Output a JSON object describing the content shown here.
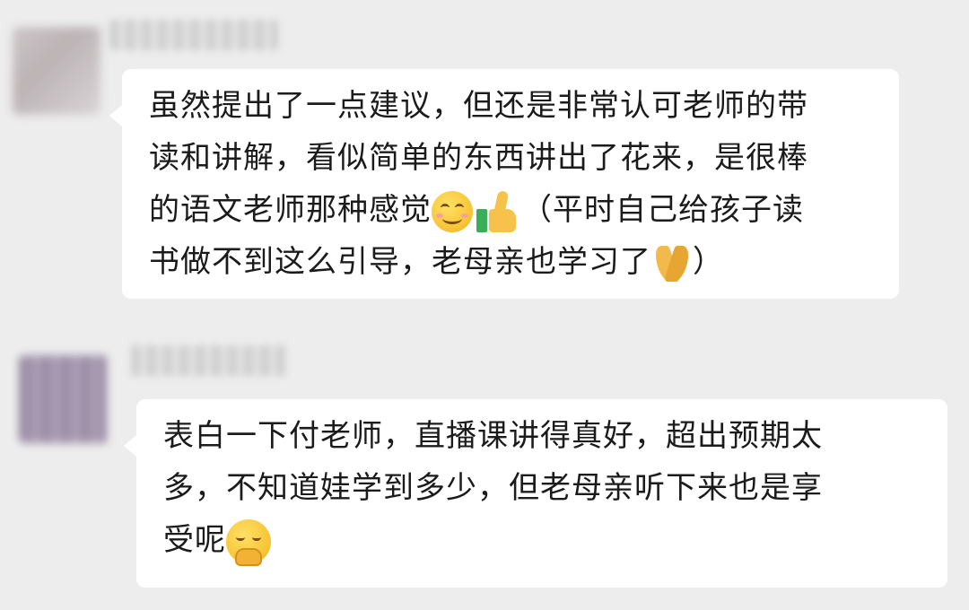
{
  "messages": [
    {
      "lines": [
        "虽然提出了一点建议，但还是非常认可老师的带",
        "读和讲解，看似简单的东西讲出了花来，是很棒",
        "的语文老师那种感觉",
        "（平时自己给孩子读",
        "书做不到这么引导，老母亲也学习了",
        "）"
      ],
      "emojis": [
        "smile-emoji",
        "thumbs-up-emoji",
        "pray-emoji"
      ]
    },
    {
      "lines": [
        "表白一下付老师，直播课讲得真好，超出预期太",
        "多，不知道娃学到多少，但老母亲听下来也是享",
        "受呢"
      ],
      "emojis": [
        "hehe-emoji"
      ]
    }
  ]
}
